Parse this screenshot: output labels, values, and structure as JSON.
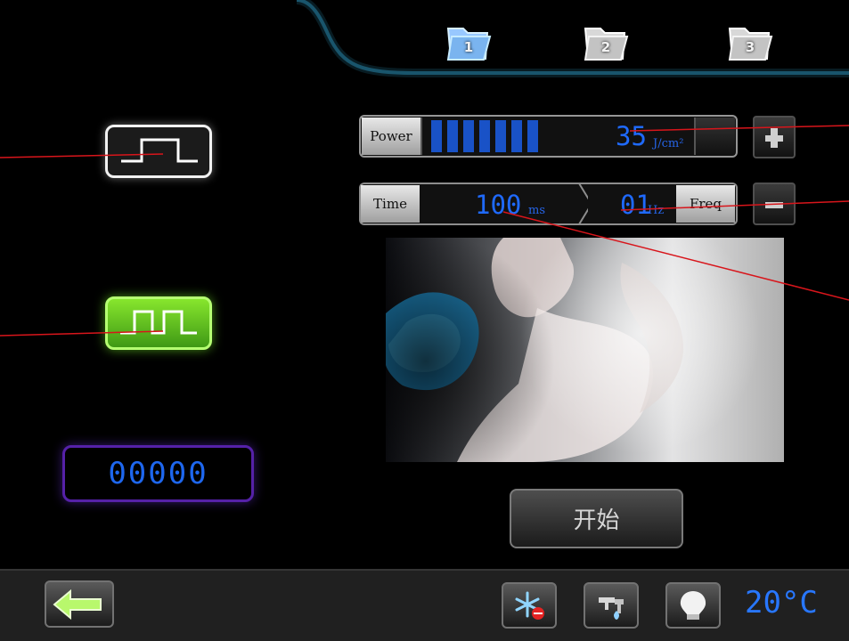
{
  "tabs": [
    {
      "label": "1"
    },
    {
      "label": "2"
    },
    {
      "label": "3"
    }
  ],
  "power": {
    "label": "Power",
    "value": "35",
    "unit": "J/cm²",
    "level_bars": 7
  },
  "time": {
    "label": "Time",
    "value": "100",
    "unit": "ms"
  },
  "freq": {
    "label": "Freq",
    "value": "01",
    "unit": "Hz"
  },
  "counter": {
    "value": "00000"
  },
  "start": {
    "label": "开始"
  },
  "temperature": {
    "value": "20°C"
  },
  "icons": {
    "back": "back-arrow-icon",
    "cooling": "snowflake-icon",
    "water": "tap-icon",
    "light": "bulb-icon",
    "plus": "plus-icon",
    "minus": "minus-icon"
  },
  "colors": {
    "accent_blue": "#1f6aff",
    "pulse_green": "#7ae02a",
    "counter_border": "#5521a8",
    "top_border": "#2a8db5"
  }
}
